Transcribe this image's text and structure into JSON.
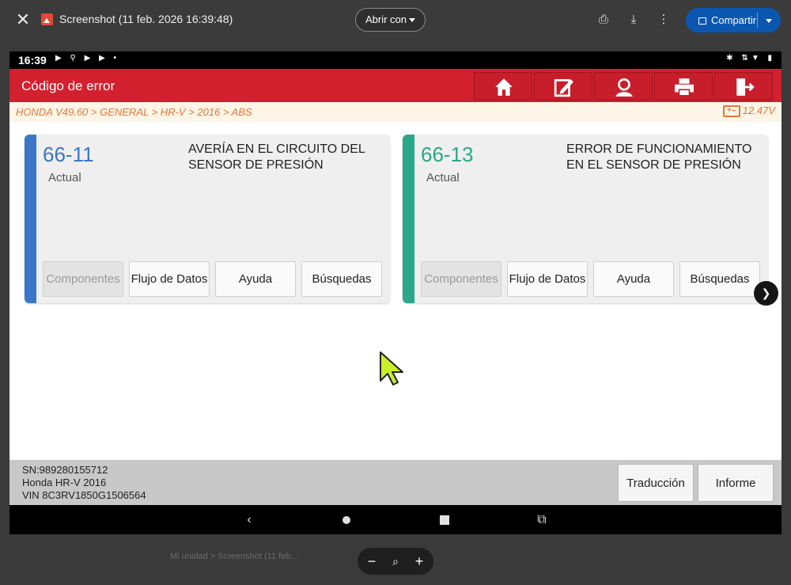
{
  "viewer": {
    "title": "Screenshot (11 feb. 2026 16:39:48)",
    "open_with": "Abrir con",
    "share": "Compartir",
    "bottom_breadcrumb": "Mi unidad  >  Screenshot (11 feb..."
  },
  "device": {
    "time": "16:39",
    "app_title": "Código de error",
    "breadcrumb": "HONDA V49.60 > GENERAL > HR-V > 2016 > ABS",
    "voltage": "12.47V",
    "cards": [
      {
        "code": "66-11",
        "status": "Actual",
        "description": "AVERÍA EN EL CIRCUITO DEL SENSOR DE PRESIÓN",
        "stripe_color": "#3a77c8",
        "code_color": "#3a77c8",
        "buttons": [
          "Componentes",
          "Flujo de Datos",
          "Ayuda",
          "Búsquedas"
        ]
      },
      {
        "code": "66-13",
        "status": "Actual",
        "description": "ERROR DE FUNCIONAMIENTO EN EL SENSOR DE PRESIÓN",
        "stripe_color": "#2aa889",
        "code_color": "#2aa889",
        "buttons": [
          "Componentes",
          "Flujo de Datos",
          "Ayuda",
          "Búsquedas"
        ]
      }
    ],
    "footer": {
      "sn": "SN:989280155712",
      "vehicle": "Honda HR-V 2016",
      "vin": "VIN 8C3RV1850G1506564",
      "translate_label": "Traducción",
      "report_label": "Informe"
    },
    "accent_color": "#d3202e"
  }
}
